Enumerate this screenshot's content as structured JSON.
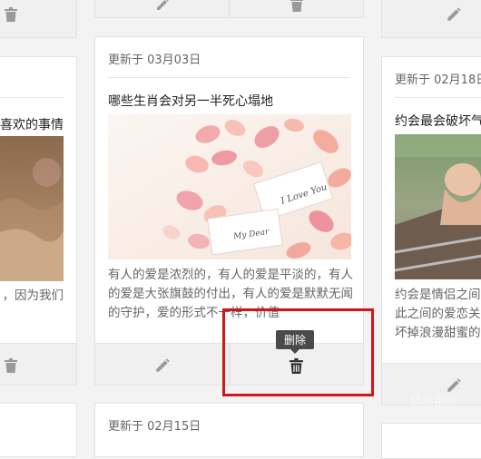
{
  "icons": {
    "edit": "pencil-icon",
    "delete": "trash-icon"
  },
  "colors": {
    "highlight": "#d01616",
    "tooltip_bg": "#4a4a4a",
    "action_bar": "#f0f0f0"
  },
  "left_card": {
    "title_fragment": "喜欢的事情",
    "excerpt_fragment": "，因为我们"
  },
  "center_card": {
    "date": "更新于 03月03日",
    "title": "哪些生肖会对另一半死心塌地",
    "image_text_1": "I Love You",
    "image_text_2": "My Dear",
    "excerpt": "有人的爱是浓烈的，有人的爱是平淡的，有人的爱是大张旗鼓的付出，有人的爱是默默无闻的守护，爱的形式不一样，价值",
    "delete_tooltip": "删除"
  },
  "right_card": {
    "date": "更新于 02月18日",
    "title": "约会最会破坏气",
    "excerpt_lines": [
      "约会是情侣之间",
      "此之间的爱恋关",
      "坏掉浪漫甜蜜的"
    ]
  },
  "bottom_card": {
    "date": "更新于 02月15日"
  },
  "watermark": "经验指南"
}
